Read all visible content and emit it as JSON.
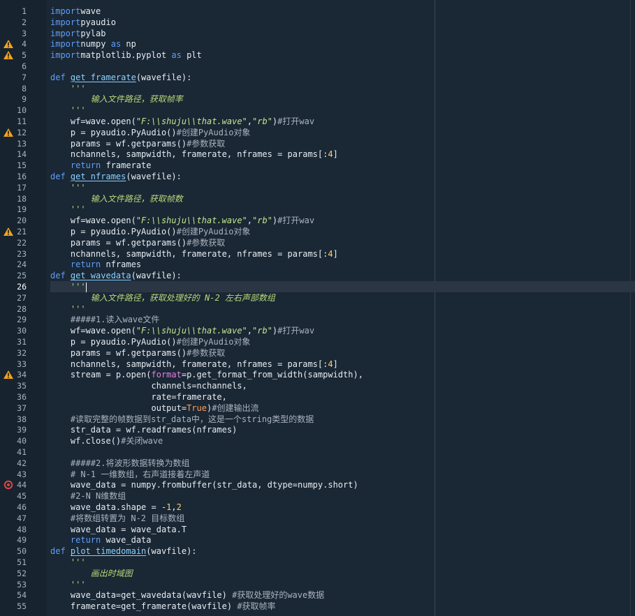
{
  "editor": {
    "current_line": 26,
    "lines": [
      {
        "n": "1",
        "marker": "",
        "segs": [
          [
            "kw",
            "import"
          ],
          [
            "",
            "wave"
          ]
        ]
      },
      {
        "n": "2",
        "marker": "",
        "segs": [
          [
            "kw",
            "import"
          ],
          [
            "",
            "pyaudio"
          ]
        ]
      },
      {
        "n": "3",
        "marker": "",
        "segs": [
          [
            "kw",
            "import"
          ],
          [
            "",
            "pylab"
          ]
        ]
      },
      {
        "n": "4",
        "marker": "warning",
        "segs": [
          [
            "kw",
            "import"
          ],
          [
            "",
            "numpy "
          ],
          [
            "kw",
            "as"
          ],
          [
            "",
            " np"
          ]
        ]
      },
      {
        "n": "5",
        "marker": "warning",
        "segs": [
          [
            "kw",
            "import"
          ],
          [
            "",
            "matplotlib.pyplot "
          ],
          [
            "kw",
            "as"
          ],
          [
            "",
            " plt"
          ]
        ]
      },
      {
        "n": "6",
        "marker": "",
        "segs": []
      },
      {
        "n": "7",
        "marker": "",
        "segs": [
          [
            "kw",
            "def "
          ],
          [
            "fn",
            "get_framerate"
          ],
          [
            "",
            "(wavefile):"
          ]
        ]
      },
      {
        "n": "8",
        "marker": "",
        "segs": [
          [
            "doc",
            "    '''"
          ]
        ]
      },
      {
        "n": "9",
        "marker": "",
        "segs": [
          [
            "doc",
            "        输入文件路径，获取帧率"
          ]
        ]
      },
      {
        "n": "10",
        "marker": "",
        "segs": [
          [
            "doc",
            "    '''"
          ]
        ]
      },
      {
        "n": "11",
        "marker": "",
        "segs": [
          [
            "",
            "    wf=wave.open("
          ],
          [
            "str",
            "\"F:\\\\shuju\\\\that.wave\""
          ],
          [
            "",
            ","
          ],
          [
            "str",
            "\"rb\""
          ],
          [
            "",
            ")"
          ],
          [
            "cmt",
            "#打开wav"
          ]
        ]
      },
      {
        "n": "12",
        "marker": "warning",
        "segs": [
          [
            "",
            "    p = pyaudio.PyAudio()"
          ],
          [
            "cmt",
            "#创建PyAudio对象"
          ]
        ]
      },
      {
        "n": "13",
        "marker": "",
        "segs": [
          [
            "",
            "    params = wf.getparams()"
          ],
          [
            "cmt",
            "#参数获取"
          ]
        ]
      },
      {
        "n": "14",
        "marker": "",
        "segs": [
          [
            "",
            "    nchannels, sampwidth, framerate, nframes = params[:"
          ],
          [
            "num",
            "4"
          ],
          [
            "",
            "]"
          ]
        ]
      },
      {
        "n": "15",
        "marker": "",
        "segs": [
          [
            "kw",
            "    return"
          ],
          [
            "",
            " framerate"
          ]
        ]
      },
      {
        "n": "16",
        "marker": "",
        "segs": [
          [
            "kw",
            "def "
          ],
          [
            "fn",
            "get_nframes"
          ],
          [
            "",
            "(wavefile):"
          ]
        ]
      },
      {
        "n": "17",
        "marker": "",
        "segs": [
          [
            "doc",
            "    '''"
          ]
        ]
      },
      {
        "n": "18",
        "marker": "",
        "segs": [
          [
            "doc",
            "        输入文件路径，获取帧数"
          ]
        ]
      },
      {
        "n": "19",
        "marker": "",
        "segs": [
          [
            "doc",
            "    '''"
          ]
        ]
      },
      {
        "n": "20",
        "marker": "",
        "segs": [
          [
            "",
            "    wf=wave.open("
          ],
          [
            "str",
            "\"F:\\\\shuju\\\\that.wave\""
          ],
          [
            "",
            ","
          ],
          [
            "str",
            "\"rb\""
          ],
          [
            "",
            ")"
          ],
          [
            "cmt",
            "#打开wav"
          ]
        ]
      },
      {
        "n": "21",
        "marker": "warning",
        "segs": [
          [
            "",
            "    p = pyaudio.PyAudio()"
          ],
          [
            "cmt",
            "#创建PyAudio对象"
          ]
        ]
      },
      {
        "n": "22",
        "marker": "",
        "segs": [
          [
            "",
            "    params = wf.getparams()"
          ],
          [
            "cmt",
            "#参数获取"
          ]
        ]
      },
      {
        "n": "23",
        "marker": "",
        "segs": [
          [
            "",
            "    nchannels, sampwidth, framerate, nframes = params[:"
          ],
          [
            "num",
            "4"
          ],
          [
            "",
            "]"
          ]
        ]
      },
      {
        "n": "24",
        "marker": "",
        "segs": [
          [
            "kw",
            "    return"
          ],
          [
            "",
            " nframes"
          ]
        ]
      },
      {
        "n": "25",
        "marker": "",
        "segs": [
          [
            "kw",
            "def "
          ],
          [
            "fn",
            "get_wavedata"
          ],
          [
            "",
            "(wavfile):"
          ]
        ]
      },
      {
        "n": "26",
        "marker": "",
        "segs": [
          [
            "doc",
            "    '''"
          ]
        ],
        "cursor": true
      },
      {
        "n": "27",
        "marker": "",
        "segs": [
          [
            "doc",
            "        输入文件路径，获取处理好的 N-2 左右声部数组"
          ]
        ]
      },
      {
        "n": "28",
        "marker": "",
        "segs": [
          [
            "doc",
            "    '''"
          ]
        ]
      },
      {
        "n": "29",
        "marker": "",
        "segs": [
          [
            "cmt",
            "    #####1.读入wave文件"
          ]
        ]
      },
      {
        "n": "30",
        "marker": "",
        "segs": [
          [
            "",
            "    wf=wave.open("
          ],
          [
            "str",
            "\"F:\\\\shuju\\\\that.wave\""
          ],
          [
            "",
            ","
          ],
          [
            "str",
            "\"rb\""
          ],
          [
            "",
            ")"
          ],
          [
            "cmt",
            "#打开wav"
          ]
        ]
      },
      {
        "n": "31",
        "marker": "",
        "segs": [
          [
            "",
            "    p = pyaudio.PyAudio()"
          ],
          [
            "cmt",
            "#创建PyAudio对象"
          ]
        ]
      },
      {
        "n": "32",
        "marker": "",
        "segs": [
          [
            "",
            "    params = wf.getparams()"
          ],
          [
            "cmt",
            "#参数获取"
          ]
        ]
      },
      {
        "n": "33",
        "marker": "",
        "segs": [
          [
            "",
            "    nchannels, sampwidth, framerate, nframes = params[:"
          ],
          [
            "num",
            "4"
          ],
          [
            "",
            "]"
          ]
        ]
      },
      {
        "n": "34",
        "marker": "warning",
        "segs": [
          [
            "",
            "    stream = p.open("
          ],
          [
            "param",
            "format"
          ],
          [
            "",
            "=p.get_format_from_width(sampwidth),"
          ]
        ]
      },
      {
        "n": "35",
        "marker": "",
        "segs": [
          [
            "",
            "                    channels=nchannels,"
          ]
        ]
      },
      {
        "n": "36",
        "marker": "",
        "segs": [
          [
            "",
            "                    rate=framerate,"
          ]
        ]
      },
      {
        "n": "37",
        "marker": "",
        "segs": [
          [
            "",
            "                    output="
          ],
          [
            "const",
            "True"
          ],
          [
            "",
            ")"
          ],
          [
            "cmt",
            "#创建输出流"
          ]
        ]
      },
      {
        "n": "38",
        "marker": "",
        "segs": [
          [
            "cmt",
            "    #读取完整的帧数据到str_data中，这是一个string类型的数据"
          ]
        ]
      },
      {
        "n": "39",
        "marker": "",
        "segs": [
          [
            "",
            "    str_data = wf.readframes(nframes)"
          ]
        ]
      },
      {
        "n": "40",
        "marker": "",
        "segs": [
          [
            "",
            "    wf.close()"
          ],
          [
            "cmt",
            "#关闭wave"
          ]
        ]
      },
      {
        "n": "41",
        "marker": "",
        "segs": []
      },
      {
        "n": "42",
        "marker": "",
        "segs": [
          [
            "cmt",
            "    #####2.将波形数据转换为数组"
          ]
        ]
      },
      {
        "n": "43",
        "marker": "",
        "segs": [
          [
            "cmt",
            "    # N-1 一维数组，右声道接着左声道"
          ]
        ]
      },
      {
        "n": "44",
        "marker": "error",
        "segs": [
          [
            "",
            "    wave_data = numpy.frombuffer(str_data, dtype=numpy.short)"
          ]
        ]
      },
      {
        "n": "45",
        "marker": "",
        "segs": [
          [
            "cmt",
            "    #2-N N维数组"
          ]
        ]
      },
      {
        "n": "46",
        "marker": "",
        "segs": [
          [
            "",
            "    wave_data.shape = -"
          ],
          [
            "num",
            "1"
          ],
          [
            "",
            ","
          ],
          [
            "num",
            "2"
          ]
        ]
      },
      {
        "n": "47",
        "marker": "",
        "segs": [
          [
            "cmt",
            "    #将数组转置为 N-2 目标数组"
          ]
        ]
      },
      {
        "n": "48",
        "marker": "",
        "segs": [
          [
            "",
            "    wave_data = wave_data.T"
          ]
        ]
      },
      {
        "n": "49",
        "marker": "",
        "segs": [
          [
            "kw",
            "    return"
          ],
          [
            "",
            " wave_data"
          ]
        ]
      },
      {
        "n": "50",
        "marker": "",
        "segs": [
          [
            "kw",
            "def "
          ],
          [
            "fn",
            "plot_timedomain"
          ],
          [
            "",
            "(wavfile):"
          ]
        ]
      },
      {
        "n": "51",
        "marker": "",
        "segs": [
          [
            "doc",
            "    '''"
          ]
        ]
      },
      {
        "n": "52",
        "marker": "",
        "segs": [
          [
            "doc",
            "        画出时域图"
          ]
        ]
      },
      {
        "n": "53",
        "marker": "",
        "segs": [
          [
            "doc",
            "    '''"
          ]
        ]
      },
      {
        "n": "54",
        "marker": "",
        "segs": [
          [
            "",
            "    wave_data=get_wavedata(wavfile) "
          ],
          [
            "cmt",
            "#获取处理好的wave数据"
          ]
        ]
      },
      {
        "n": "55",
        "marker": "",
        "segs": [
          [
            "",
            "    framerate=get_framerate(wavfile) "
          ],
          [
            "cmt",
            "#获取帧率"
          ]
        ]
      }
    ]
  },
  "colors": {
    "background": "#1a2734",
    "keyword": "#5f9ff7",
    "string": "#c2e88e",
    "comment": "#a9b4bf",
    "warning": "#f2a31c",
    "error": "#e04545"
  }
}
